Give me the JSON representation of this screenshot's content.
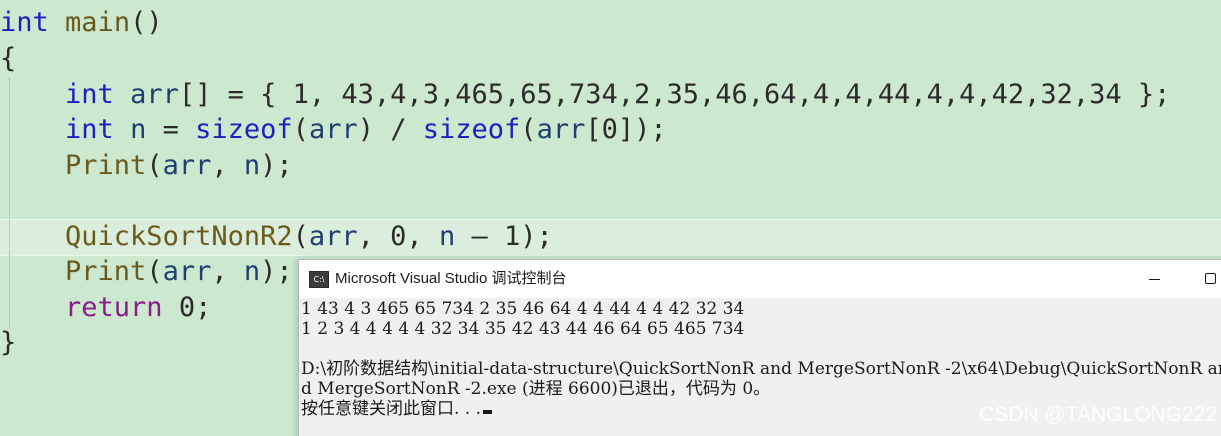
{
  "editor": {
    "lines": [
      {
        "segments": [
          {
            "t": "int",
            "c": "kw"
          },
          {
            "t": " ",
            "c": "plain"
          },
          {
            "t": "main",
            "c": "fn"
          },
          {
            "t": "()",
            "c": "plain"
          }
        ]
      },
      {
        "segments": [
          {
            "t": "{",
            "c": "plain"
          }
        ]
      },
      {
        "segments": [
          {
            "t": "    ",
            "c": "plain"
          },
          {
            "t": "int",
            "c": "kw"
          },
          {
            "t": " ",
            "c": "plain"
          },
          {
            "t": "arr",
            "c": "var"
          },
          {
            "t": "[] = { 1, 43,4,3,465,65,734,2,35,46,64,4,4,44,4,4,42,32,34 };",
            "c": "plain"
          }
        ]
      },
      {
        "segments": [
          {
            "t": "    ",
            "c": "plain"
          },
          {
            "t": "int",
            "c": "kw"
          },
          {
            "t": " ",
            "c": "plain"
          },
          {
            "t": "n",
            "c": "var"
          },
          {
            "t": " = ",
            "c": "plain"
          },
          {
            "t": "sizeof",
            "c": "kw"
          },
          {
            "t": "(",
            "c": "plain"
          },
          {
            "t": "arr",
            "c": "var"
          },
          {
            "t": ") / ",
            "c": "plain"
          },
          {
            "t": "sizeof",
            "c": "kw"
          },
          {
            "t": "(",
            "c": "plain"
          },
          {
            "t": "arr",
            "c": "var"
          },
          {
            "t": "[0]);",
            "c": "plain"
          }
        ]
      },
      {
        "segments": [
          {
            "t": "    ",
            "c": "plain"
          },
          {
            "t": "Print",
            "c": "fn"
          },
          {
            "t": "(",
            "c": "plain"
          },
          {
            "t": "arr",
            "c": "var"
          },
          {
            "t": ", ",
            "c": "plain"
          },
          {
            "t": "n",
            "c": "var"
          },
          {
            "t": ");",
            "c": "plain"
          }
        ]
      },
      {
        "segments": []
      },
      {
        "segments": [
          {
            "t": "    ",
            "c": "plain"
          },
          {
            "t": "QuickSortNonR2",
            "c": "fn"
          },
          {
            "t": "(",
            "c": "plain"
          },
          {
            "t": "arr",
            "c": "var"
          },
          {
            "t": ", 0, ",
            "c": "plain"
          },
          {
            "t": "n",
            "c": "var"
          },
          {
            "t": " – 1);",
            "c": "plain"
          }
        ]
      },
      {
        "segments": [
          {
            "t": "    ",
            "c": "plain"
          },
          {
            "t": "Print",
            "c": "fn"
          },
          {
            "t": "(",
            "c": "plain"
          },
          {
            "t": "arr",
            "c": "var"
          },
          {
            "t": ", ",
            "c": "plain"
          },
          {
            "t": "n",
            "c": "var"
          },
          {
            "t": ");",
            "c": "plain"
          }
        ]
      },
      {
        "segments": [
          {
            "t": "    ",
            "c": "plain"
          },
          {
            "t": "return",
            "c": "kw2"
          },
          {
            "t": " 0;",
            "c": "plain"
          }
        ]
      },
      {
        "segments": [
          {
            "t": "}",
            "c": "plain"
          }
        ]
      }
    ]
  },
  "console": {
    "icon_label": "C:\\",
    "title": "Microsoft Visual Studio 调试控制台",
    "minimize_icon": "minimize-icon",
    "maximize_icon": "maximize-icon",
    "output_lines": [
      "1 43 4 3 465 65 734 2 35 46 64 4 4 44 4 4 42 32 34",
      "1 2 3 4 4 4 4 4 32 34 35 42 43 44 46 64 65 465 734",
      "",
      "D:\\初阶数据结构\\initial-data-structure\\QuickSortNonR and MergeSortNonR -2\\x64\\Debug\\QuickSortNonR an",
      "d MergeSortNonR -2.exe (进程 6600)已退出，代码为 0。",
      "按任意键关闭此窗口. . ."
    ]
  },
  "watermark": "CSDN @TANGLONG222"
}
